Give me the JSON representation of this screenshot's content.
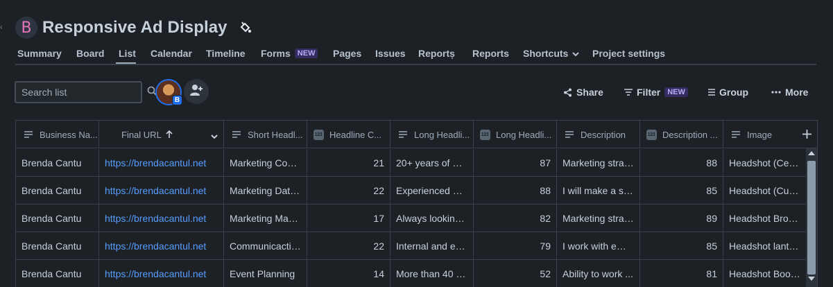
{
  "project": {
    "avatar_letter": "B",
    "title": "Responsive Ad Display"
  },
  "tabs": [
    {
      "label": "Summary"
    },
    {
      "label": "Board"
    },
    {
      "label": "List",
      "active": true
    },
    {
      "label": "Calendar"
    },
    {
      "label": "Timeline"
    },
    {
      "label": "Forms",
      "badge": "NEW"
    },
    {
      "label": "Pages"
    },
    {
      "label": "Issues"
    },
    {
      "label": "Reportṣ"
    },
    {
      "label": "Reports"
    },
    {
      "label": "Shortcuts"
    },
    {
      "label": "Project settings"
    }
  ],
  "search": {
    "placeholder": "Search list"
  },
  "user_avatar": {
    "badge": "B"
  },
  "toolbar": {
    "share_label": "Share",
    "filter_label": "Filter",
    "filter_badge": "NEW",
    "group_label": "Group",
    "more_label": "More"
  },
  "columns": [
    {
      "label": "Business Na...",
      "type": "text"
    },
    {
      "label": "Final URL",
      "type": "sort"
    },
    {
      "label": "Short Headl...",
      "type": "text"
    },
    {
      "label": "Headline C...",
      "type": "number"
    },
    {
      "label": "Long Headli...",
      "type": "text"
    },
    {
      "label": "Long Headli...",
      "type": "number"
    },
    {
      "label": "Description",
      "type": "text"
    },
    {
      "label": "Description ...",
      "type": "number"
    },
    {
      "label": "Image",
      "type": "text"
    }
  ],
  "number_icon_text": "123",
  "rows": [
    [
      "Brenda Cantu",
      "https://brendacantul.net",
      "Marketing Coor...",
      "21",
      "20+ years of ex...",
      "87",
      "Marketing strat...",
      "88",
      "Headshot (Cerr..."
    ],
    [
      "Brenda Cantu",
      "https://brendacantul.net",
      "Marketing Data ...",
      "22",
      "Experienced pro...",
      "88",
      "I will make a sig...",
      "85",
      "Headshot (Cube..."
    ],
    [
      "Brenda Cantu",
      "https://brendacantul.net",
      "Marketing Man...",
      "17",
      "Always looking ...",
      "82",
      "Marketing strat...",
      "89",
      "Headshot Brow..."
    ],
    [
      "Brenda Cantu",
      "https://brendacantul.net",
      "Communicactio...",
      "22",
      "Internal and ext...",
      "79",
      "I work with emp...",
      "85",
      "Headshot lanter..."
    ],
    [
      "Brenda Cantu",
      "https://brendacantul.net",
      "Event Planning",
      "14",
      "More than 40 e...",
      "52",
      "Ability to work ...",
      "81",
      "Headshot Book..."
    ]
  ],
  "colors": {
    "background": "#1d2125",
    "link": "#579dff",
    "badge_bg": "#352c63",
    "badge_text": "#b8acf6",
    "avatar_ring": "#1f6feb"
  }
}
